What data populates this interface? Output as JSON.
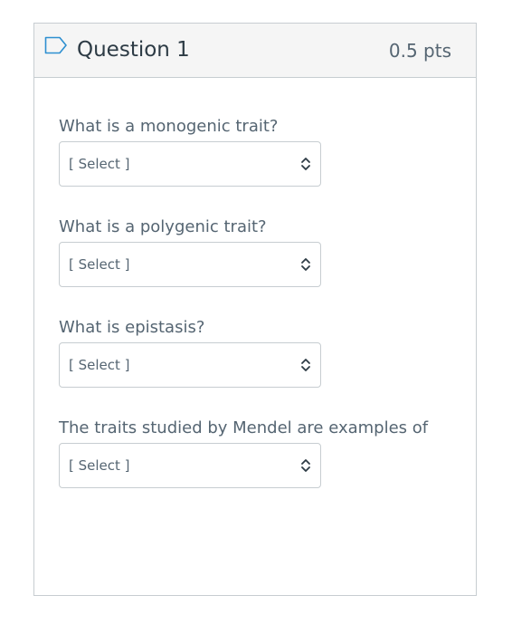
{
  "question": {
    "title": "Question 1",
    "points": "0.5 pts",
    "items": [
      {
        "prompt": "What is a monogenic trait?",
        "selected": "[ Select ]"
      },
      {
        "prompt": "What is a polygenic trait?",
        "selected": "[ Select ]"
      },
      {
        "prompt": "What is epistasis?",
        "selected": "[ Select ]"
      },
      {
        "prompt": "The traits studied by Mendel are examples of",
        "selected": "[ Select ]"
      }
    ]
  },
  "icons": {
    "flag": "flag-outline-icon",
    "select": "chevron-up-down-icon"
  },
  "colors": {
    "border": "#c7cdd1",
    "header_bg": "#f5f5f5",
    "text": "#556572",
    "title": "#2d3b45"
  }
}
